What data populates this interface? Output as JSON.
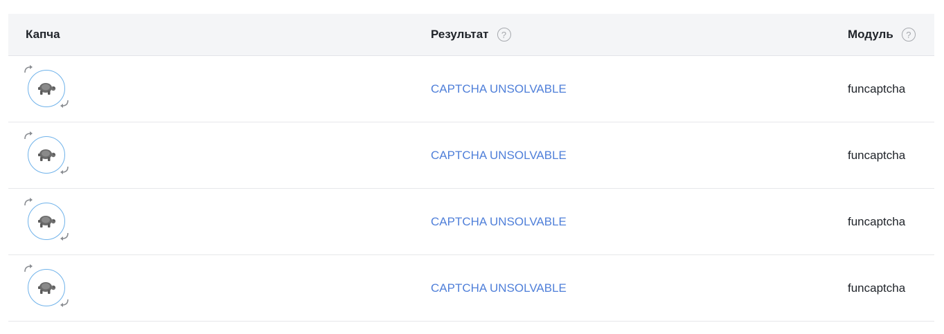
{
  "table": {
    "headers": {
      "captcha": "Капча",
      "result": "Результат",
      "module": "Модуль",
      "help_symbol": "?"
    },
    "rows": [
      {
        "result": "CAPTCHA UNSOLVABLE",
        "module": "funcaptcha",
        "image_icon": "turtle-icon"
      },
      {
        "result": "CAPTCHA UNSOLVABLE",
        "module": "funcaptcha",
        "image_icon": "turtle-icon"
      },
      {
        "result": "CAPTCHA UNSOLVABLE",
        "module": "funcaptcha",
        "image_icon": "turtle-icon"
      },
      {
        "result": "CAPTCHA UNSOLVABLE",
        "module": "funcaptcha",
        "image_icon": "turtle-icon"
      }
    ]
  },
  "colors": {
    "header_bg": "#f4f5f7",
    "link": "#4f7fd9",
    "circle_border": "#6fb2ea",
    "text": "#1f2329",
    "help_icon": "#a6a9ae"
  }
}
